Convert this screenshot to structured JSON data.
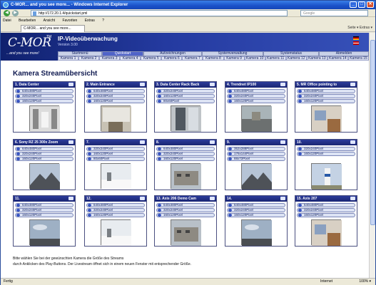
{
  "window": {
    "title": "C-MOR... and you see more... - Windows Internet Explorer",
    "min": "_",
    "max": "□",
    "close": "✕"
  },
  "browser": {
    "address": "http://172.20.1.4/quickstart.pml",
    "search_placeholder": "Google",
    "menu": [
      "Datei",
      "Bearbeiten",
      "Ansicht",
      "Favoriten",
      "Extras",
      "?"
    ],
    "tab_title": "C-MOR... and you see more... ",
    "tab_tools": "Seite ▾  Extras ▾",
    "status_text": "Fertig",
    "zone": "Internet",
    "zoom": "100% ▾"
  },
  "app": {
    "brand": "C-MOR",
    "trademark": "TM",
    "slogan": "...and you see more!",
    "title": "IP-Videoüberwachung",
    "version": "Version 3.00",
    "nav_primary": [
      {
        "label": "Startmenü",
        "active": false
      },
      {
        "label": "Quickstart",
        "active": true
      },
      {
        "label": "Aufzeichnungen",
        "active": false
      },
      {
        "label": "Systemverwaltung",
        "active": false
      },
      {
        "label": "Systemstatus",
        "active": false
      },
      {
        "label": "Abmelden",
        "active": false
      }
    ],
    "nav_cameras": [
      "Kamera 1",
      "Kamera 2",
      "Kamera 3",
      "Kamera 4",
      "Kamera 5",
      "Kamera 6",
      "Kamera 7",
      "Kamera 8",
      "Kamera 9",
      "Kamera 10",
      "Kamera 11",
      "Kamera 12",
      "Kamera 13",
      "Kamera 14",
      "Kamera 15"
    ],
    "page_title": "Kamera Streamübersicht",
    "footer_line1": "Bitte wählen Sie bei der gewünschten Kamera die Größe des Streams",
    "footer_line2": "durch Anklicken des Play-Buttons. Der Livestream öffnet sich in einem neuen Fenster mit entsprechender Größe."
  },
  "cameras": [
    {
      "name": "1. Data Center",
      "resolutions": [
        "640x480Pixel",
        "320x240Pixel",
        "160x120Pixel"
      ],
      "scene": "corridor"
    },
    {
      "name": "2. Main Entrance",
      "resolutions": [
        "640x480Pixel",
        "320x240Pixel",
        "160x120Pixel"
      ],
      "scene": "entrance"
    },
    {
      "name": "3. Data Center Rack Back",
      "resolutions": [
        "320x240Pixel",
        "160x120Pixel",
        "80x60Pixel"
      ],
      "scene": "rack"
    },
    {
      "name": "4. Trendnet IP100",
      "resolutions": [
        "640x480Pixel",
        "320x240Pixel",
        "160x120Pixel"
      ],
      "scene": "street"
    },
    {
      "name": "5. MR Office pointing to",
      "resolutions": [
        "640x480Pixel",
        "320x240Pixel",
        "160x120Pixel"
      ],
      "scene": "office"
    },
    {
      "name": "6. Sony RZ 25 300x Zoom",
      "resolutions": [
        "640x480Pixel",
        "320x240Pixel",
        "160x120Pixel"
      ],
      "scene": "mountain"
    },
    {
      "name": "7.",
      "resolutions": [
        "320x240Pixel",
        "160x120Pixel",
        "80x60Pixel"
      ],
      "scene": "snow"
    },
    {
      "name": "8.",
      "resolutions": [
        "640x480Pixel",
        "320x240Pixel",
        "160x120Pixel"
      ],
      "scene": "building"
    },
    {
      "name": "9.",
      "resolutions": [
        "352x288Pixel",
        "176x144Pixel",
        "88x72Pixel"
      ],
      "scene": "mountain"
    },
    {
      "name": "10.",
      "resolutions": [
        "320x240Pixel",
        "160x120Pixel"
      ],
      "scene": "lighthouse"
    },
    {
      "name": "11.",
      "resolutions": [
        "640x480Pixel",
        "320x240Pixel",
        "160x120Pixel"
      ],
      "scene": "sky"
    },
    {
      "name": "12.",
      "resolutions": [
        "640x480Pixel",
        "320x240Pixel",
        "160x120Pixel"
      ],
      "scene": "snow"
    },
    {
      "name": "13. Axis 206 Demo Cam",
      "resolutions": [
        "640x480Pixel",
        "320x240Pixel",
        "160x120Pixel"
      ],
      "scene": "building"
    },
    {
      "name": "14.",
      "resolutions": [
        "640x480Pixel",
        "320x240Pixel",
        "160x120Pixel"
      ],
      "scene": "sky"
    },
    {
      "name": "15. Axis 207",
      "resolutions": [
        "640x480Pixel",
        "320x240Pixel",
        "160x120Pixel"
      ],
      "scene": "office"
    }
  ]
}
